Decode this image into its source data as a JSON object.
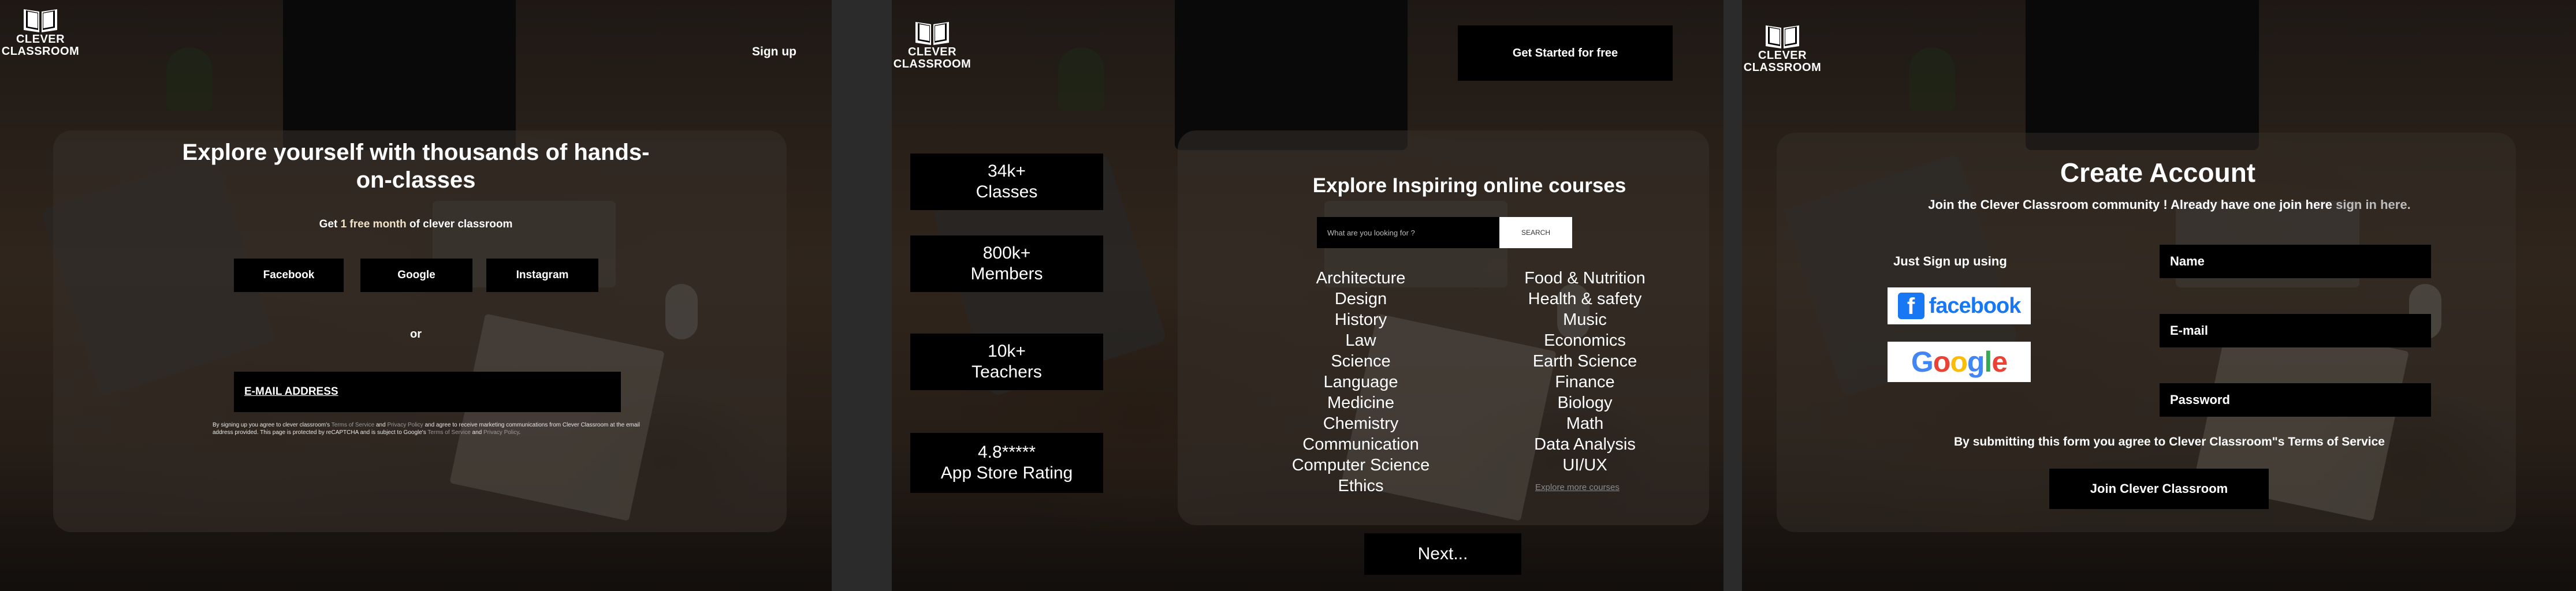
{
  "logo": {
    "line1": "CLEVER",
    "line2": "CLASSROOM"
  },
  "screen1": {
    "signup_label": "Sign up",
    "headline": "Explore yourself with thousands of hands-on-classes",
    "sub_pre": "Get ",
    "sub_highlight": "1 free month",
    "sub_post": " of clever classroom",
    "buttons": [
      "Facebook",
      "Google",
      "Instagram"
    ],
    "or_label": "or",
    "email_label": "E-MAIL ADDRESS",
    "legal_1": "By signing up you agree to clever classroom's ",
    "legal_terms": "Terms of Service",
    "legal_2": " and ",
    "legal_privacy": "Privacy Policy",
    "legal_3": " and agree to receive marketing communications from Clever Classroom at the email address provided. This page is protected by reCAPTCHA and is subject to Google's ",
    "legal_terms2": "Terms of Service",
    "legal_4": " and ",
    "legal_privacy2": "Privacy Policy",
    "legal_5": "."
  },
  "screen2": {
    "get_started_label": "Get Started for free",
    "stats": [
      {
        "value": "34k+",
        "label": "Classes"
      },
      {
        "value": "800k+",
        "label": "Members"
      },
      {
        "value": "10k+",
        "label": "Teachers"
      },
      {
        "value": "4.8*****",
        "label": "App Store Rating"
      }
    ],
    "title": "Explore Inspiring online courses",
    "search_placeholder": "What are you looking for ?",
    "search_button": "SEARCH",
    "courses_left": [
      "Architecture",
      "Design",
      "History",
      "Law",
      "Science",
      "Language",
      "Medicine",
      "Chemistry",
      "Communication",
      "Computer Science",
      "Ethics"
    ],
    "courses_right": [
      "Food & Nutrition",
      "Health & safety",
      "Music",
      "Economics",
      "Earth Science",
      "Finance",
      "Biology",
      "Math",
      "Data Analysis",
      "UI/UX"
    ],
    "explore_more": "Explore more courses",
    "next_label": "Next..."
  },
  "screen3": {
    "title": "Create Account",
    "join_text": "Join the Clever Classroom community !  Already have one join here ",
    "join_link": "sign in here.",
    "just_sign": "Just Sign up using",
    "facebook_label": "facebook",
    "google_label": "Google",
    "fields": [
      "Name",
      "E-mail",
      "Password"
    ],
    "terms": "By submitting this form you agree to Clever Classroom\"s Terms of Service",
    "join_button": "Join Clever Classroom"
  },
  "colors": {
    "google_blue": "#4285f4",
    "google_red": "#ea4335",
    "google_yellow": "#fbbc05",
    "google_green": "#34a853",
    "facebook_blue": "#1877f2"
  }
}
